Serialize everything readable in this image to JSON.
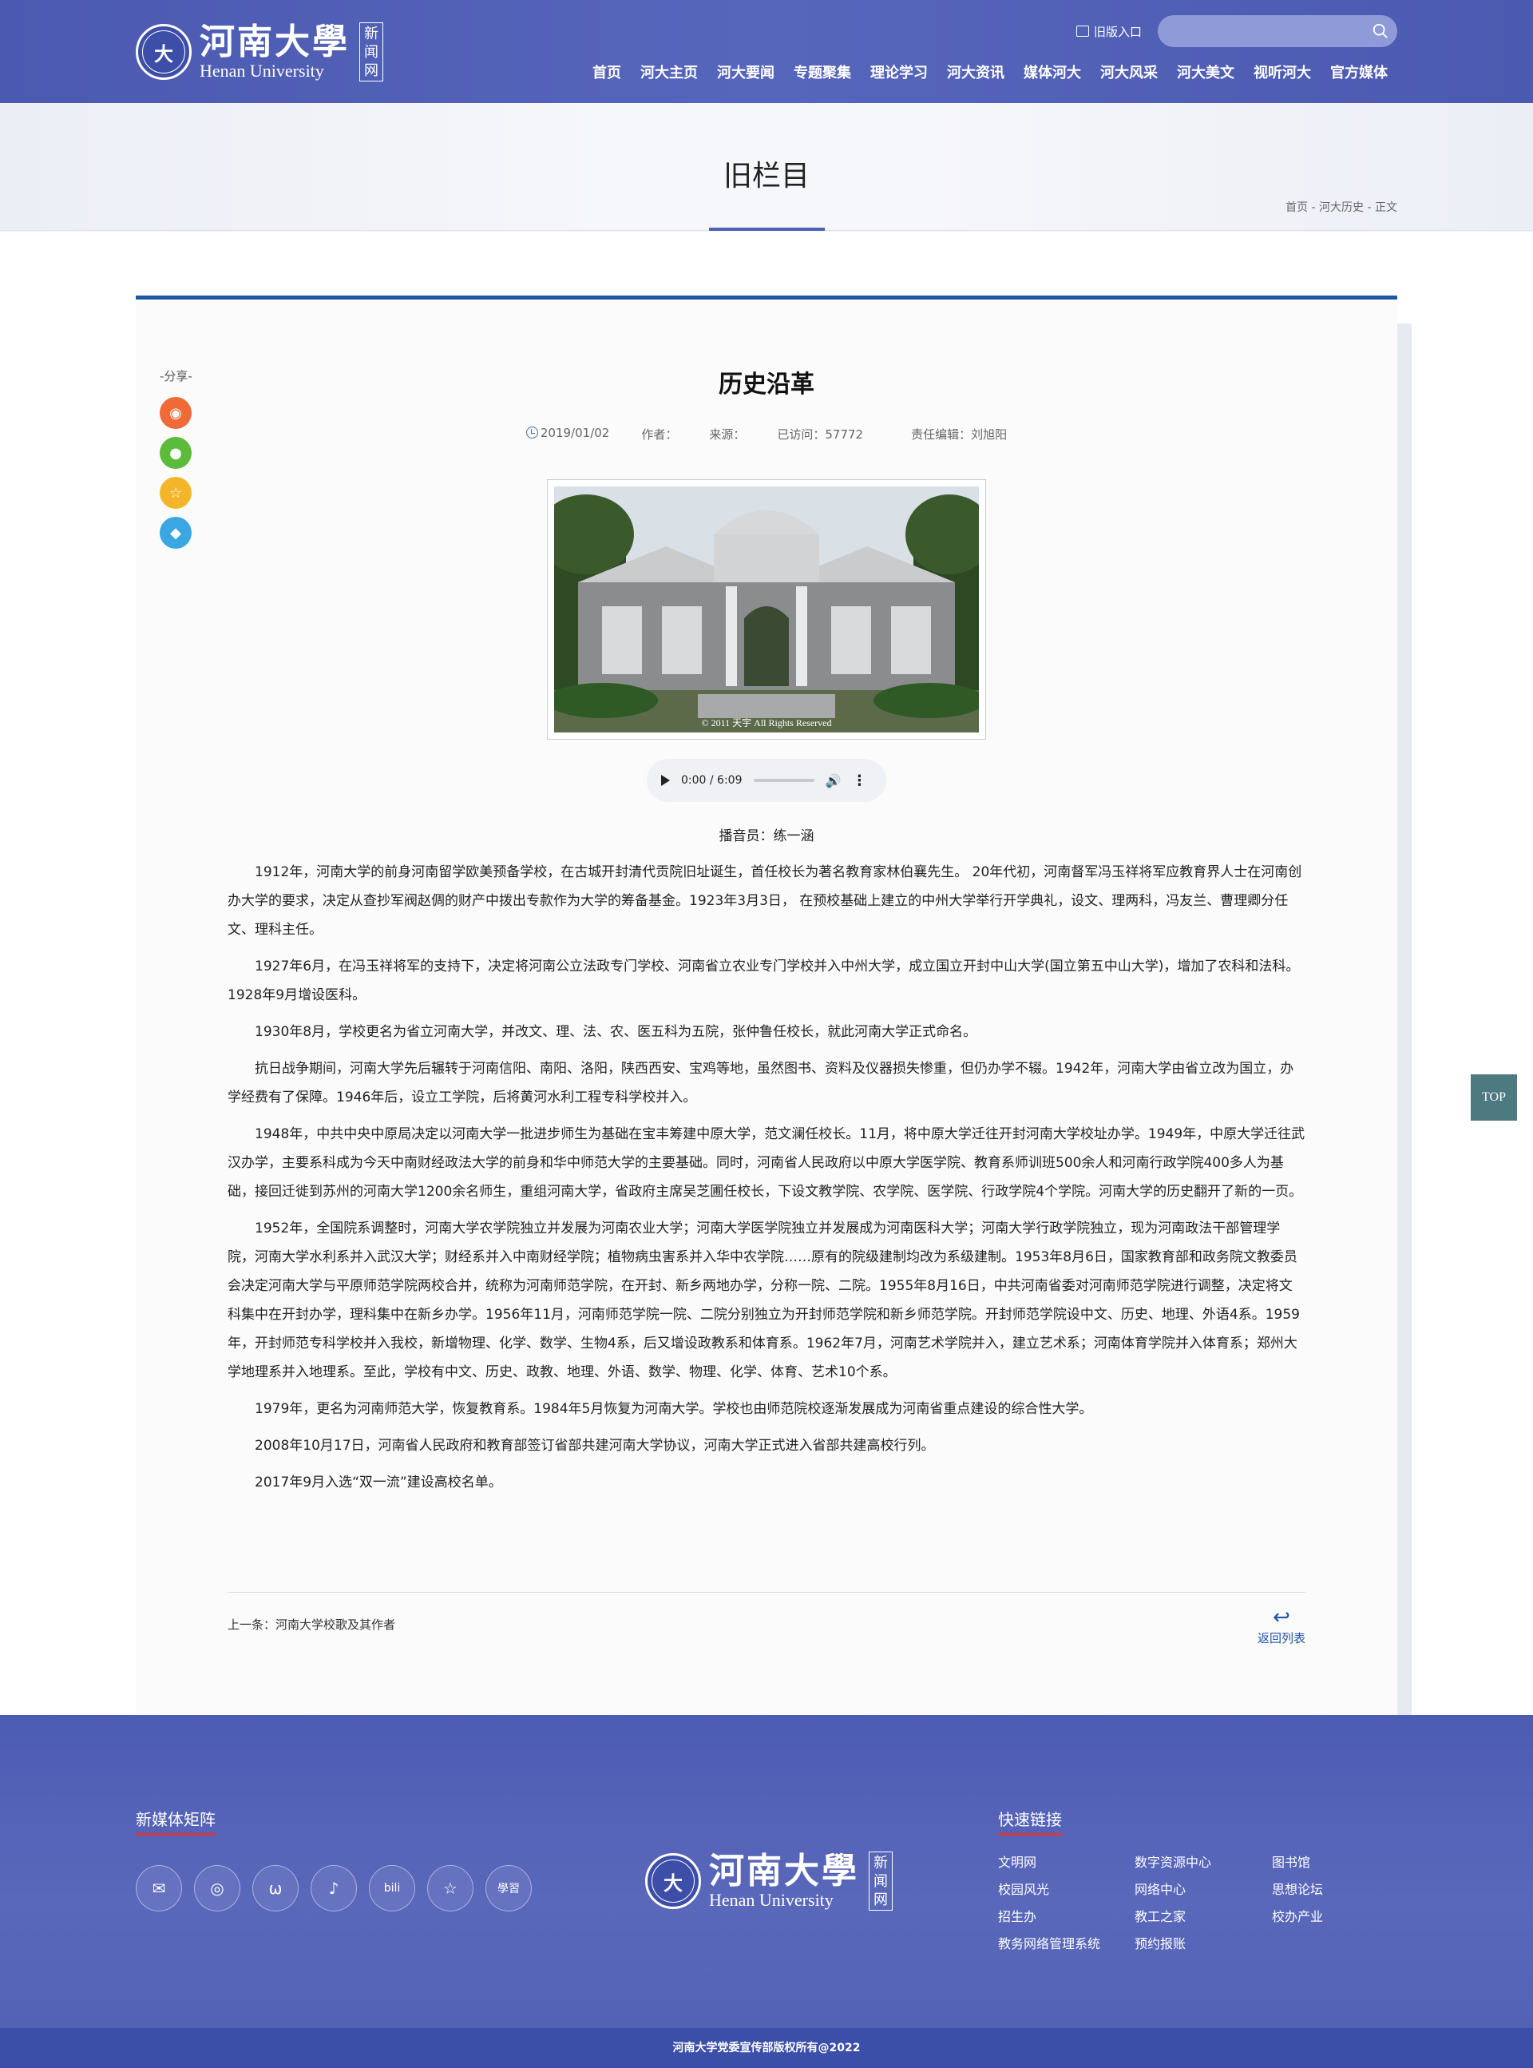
{
  "header": {
    "logo_cn": "河南大學",
    "logo_en": "Henan University",
    "logo_tag": "新闻网",
    "old_entry": "旧版入口",
    "nav": [
      "首页",
      "河大主页",
      "河大要闻",
      "专题聚集",
      "理论学习",
      "河大资讯",
      "媒体河大",
      "河大风采",
      "河大美文",
      "视听河大",
      "官方媒体"
    ]
  },
  "banner": {
    "title": "旧栏目",
    "breadcrumb": "首页 - 河大历史 - 正文"
  },
  "share": {
    "label": "-分享-",
    "buttons": [
      {
        "name": "weibo-icon",
        "color": "#ef6a36"
      },
      {
        "name": "wechat-icon",
        "color": "#5dbb3b"
      },
      {
        "name": "favorite-icon",
        "color": "#f5b52a"
      },
      {
        "name": "qq-icon",
        "color": "#3aa6e2"
      }
    ]
  },
  "article": {
    "title": "历史沿革",
    "date": "2019/01/02",
    "author": "作者：",
    "source": "来源：",
    "visits": "已访问：57772",
    "editor": "责任编辑：刘旭阳",
    "photo_caption": "© 2011 天宇 All Rights Reserved",
    "audio_time": "0:00 / 6:09",
    "announcer": "播音员：练一涵",
    "paragraphs": [
      "1912年，河南大学的前身河南留学欧美预备学校，在古城开封清代贡院旧址诞生，首任校长为著名教育家林伯襄先生。 20年代初，河南督军冯玉祥将军应教育界人士在河南创办大学的要求，决定从查抄军阀赵倜的财产中拨出专款作为大学的筹备基金。1923年3月3日， 在预校基础上建立的中州大学举行开学典礼，设文、理两科，冯友兰、曹理卿分任文、理科主任。",
      "1927年6月，在冯玉祥将军的支持下，决定将河南公立法政专门学校、河南省立农业专门学校并入中州大学，成立国立开封中山大学(国立第五中山大学)，增加了农科和法科。1928年9月增设医科。",
      "1930年8月，学校更名为省立河南大学，并改文、理、法、农、医五科为五院，张仲鲁任校长，就此河南大学正式命名。",
      "抗日战争期间，河南大学先后辗转于河南信阳、南阳、洛阳，陕西西安、宝鸡等地，虽然图书、资料及仪器损失惨重，但仍办学不辍。1942年，河南大学由省立改为国立，办学经费有了保障。1946年后，设立工学院，后将黄河水利工程专科学校并入。",
      "1948年，中共中央中原局决定以河南大学一批进步师生为基础在宝丰筹建中原大学，范文澜任校长。11月，将中原大学迁往开封河南大学校址办学。1949年，中原大学迁往武汉办学，主要系科成为今天中南财经政法大学的前身和华中师范大学的主要基础。同时，河南省人民政府以中原大学医学院、教育系师训班500余人和河南行政学院400多人为基础，接回迁徙到苏州的河南大学1200余名师生，重组河南大学，省政府主席吴芝圃任校长，下设文教学院、农学院、医学院、行政学院4个学院。河南大学的历史翻开了新的一页。",
      "1952年，全国院系调整时，河南大学农学院独立并发展为河南农业大学；河南大学医学院独立并发展成为河南医科大学；河南大学行政学院独立，现为河南政法干部管理学院，河南大学水利系并入武汉大学；财经系并入中南财经学院；植物病虫害系并入华中农学院……原有的院级建制均改为系级建制。1953年8月6日，国家教育部和政务院文教委员会决定河南大学与平原师范学院两校合并，统称为河南师范学院，在开封、新乡两地办学，分称一院、二院。1955年8月16日，中共河南省委对河南师范学院进行调整，决定将文科集中在开封办学，理科集中在新乡办学。1956年11月，河南师范学院一院、二院分别独立为开封师范学院和新乡师范学院。开封师范学院设中文、历史、地理、外语4系。1959年，开封师范专科学校并入我校，新增物理、化学、数学、生物4系，后又增设政教系和体育系。1962年7月，河南艺术学院并入，建立艺术系；河南体育学院并入体育系；郑州大学地理系并入地理系。至此，学校有中文、历史、政教、地理、外语、数学、物理、化学、体育、艺术10个系。",
      "1979年，更名为河南师范大学，恢复教育系。1984年5月恢复为河南大学。学校也由师范院校逐渐发展成为河南省重点建设的综合性大学。",
      "2008年10月17日，河南省人民政府和教育部签订省部共建河南大学协议，河南大学正式进入省部共建高校行列。",
      "2017年9月入选“双一流”建设高校名单。"
    ],
    "prev": "上一条：河南大学校歌及其作者",
    "back": "返回列表"
  },
  "top_button": "TOP",
  "footer": {
    "media_title": "新媒体矩阵",
    "media_icons": [
      "wechat-icon",
      "weibo-icon",
      "butterfly-icon",
      "tiktok-icon",
      "bilibili-icon",
      "favorite-icon",
      "xuexi-icon"
    ],
    "media_glyphs": [
      "✉",
      "◎",
      "ω",
      "♪",
      "bili",
      "☆",
      "學習"
    ],
    "logo_cn": "河南大學",
    "logo_en": "Henan University",
    "logo_tag": "新闻网",
    "links_title": "快速链接",
    "links": [
      "文明网",
      "数字资源中心",
      "图书馆",
      "校园风光",
      "网络中心",
      "思想论坛",
      "招生办",
      "教工之家",
      "校办产业",
      "教务网络管理系统",
      "预约报账"
    ],
    "copyright": "河南大学党委宣传部版权所有@2022"
  }
}
